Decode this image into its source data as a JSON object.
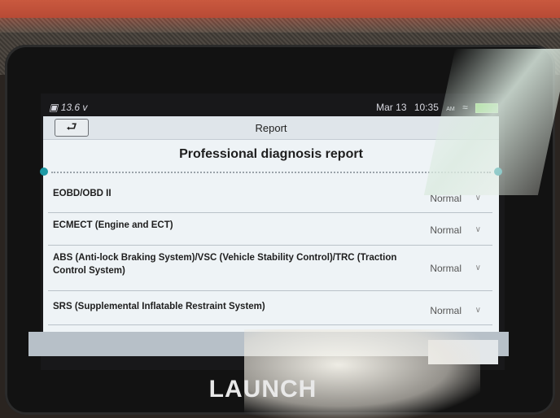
{
  "status": {
    "voltage": "13.6",
    "voltage_unit": "v",
    "date": "Mar 13",
    "time": "10:35",
    "time_suffix": "AM"
  },
  "window": {
    "title": "Report",
    "back_icon": "back-arrow-icon"
  },
  "report": {
    "heading": "Professional diagnosis report",
    "rows": [
      {
        "label": "EOBD/OBD II",
        "status": "Normal"
      },
      {
        "label": "ECMECT (Engine and ECT)",
        "status": "Normal"
      },
      {
        "label": "ABS (Anti-lock Braking System)/VSC (Vehicle Stability Control)/TRC (Traction Control System)",
        "status": "Normal"
      },
      {
        "label": "SRS (Supplemental Inflatable Restraint System)",
        "status": "Normal"
      }
    ]
  },
  "device": {
    "brand": "LAUNCH"
  },
  "colors": {
    "accent": "#1e9aa6",
    "battery": "#7fd45a"
  }
}
